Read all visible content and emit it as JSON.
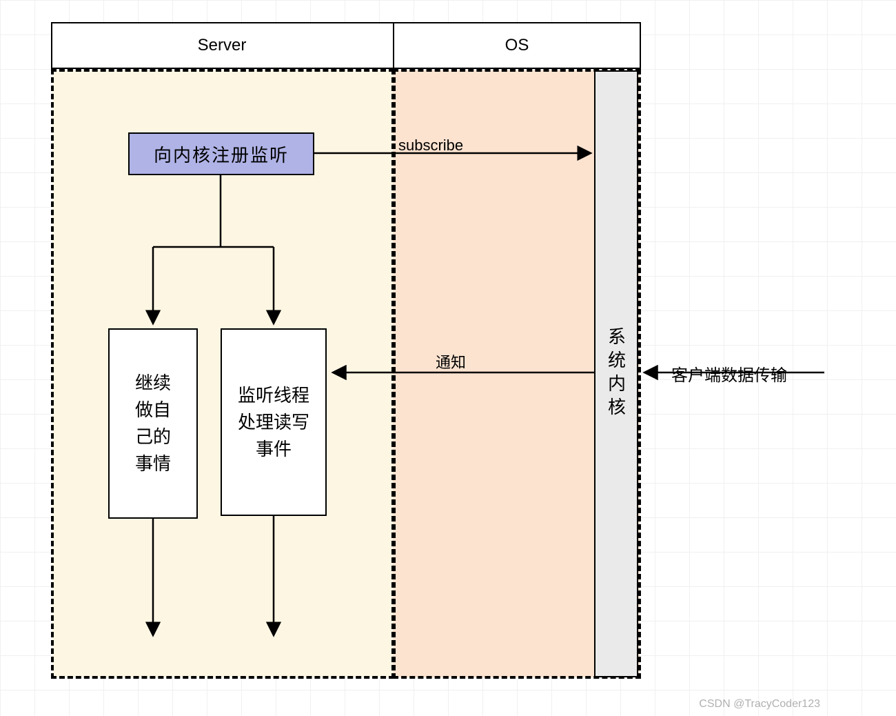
{
  "header": {
    "server": "Server",
    "os": "OS"
  },
  "nodes": {
    "register": "向内核注册监听",
    "continue_own": "继续\n做自\n己的\n事情",
    "listener_handle": "监听线程\n处理读写\n事件",
    "kernel": "系统内核",
    "client_data": "客户端数据传输"
  },
  "edges": {
    "subscribe": "subscribe",
    "notify": "通知"
  },
  "watermark": "CSDN @TracyCoder123"
}
